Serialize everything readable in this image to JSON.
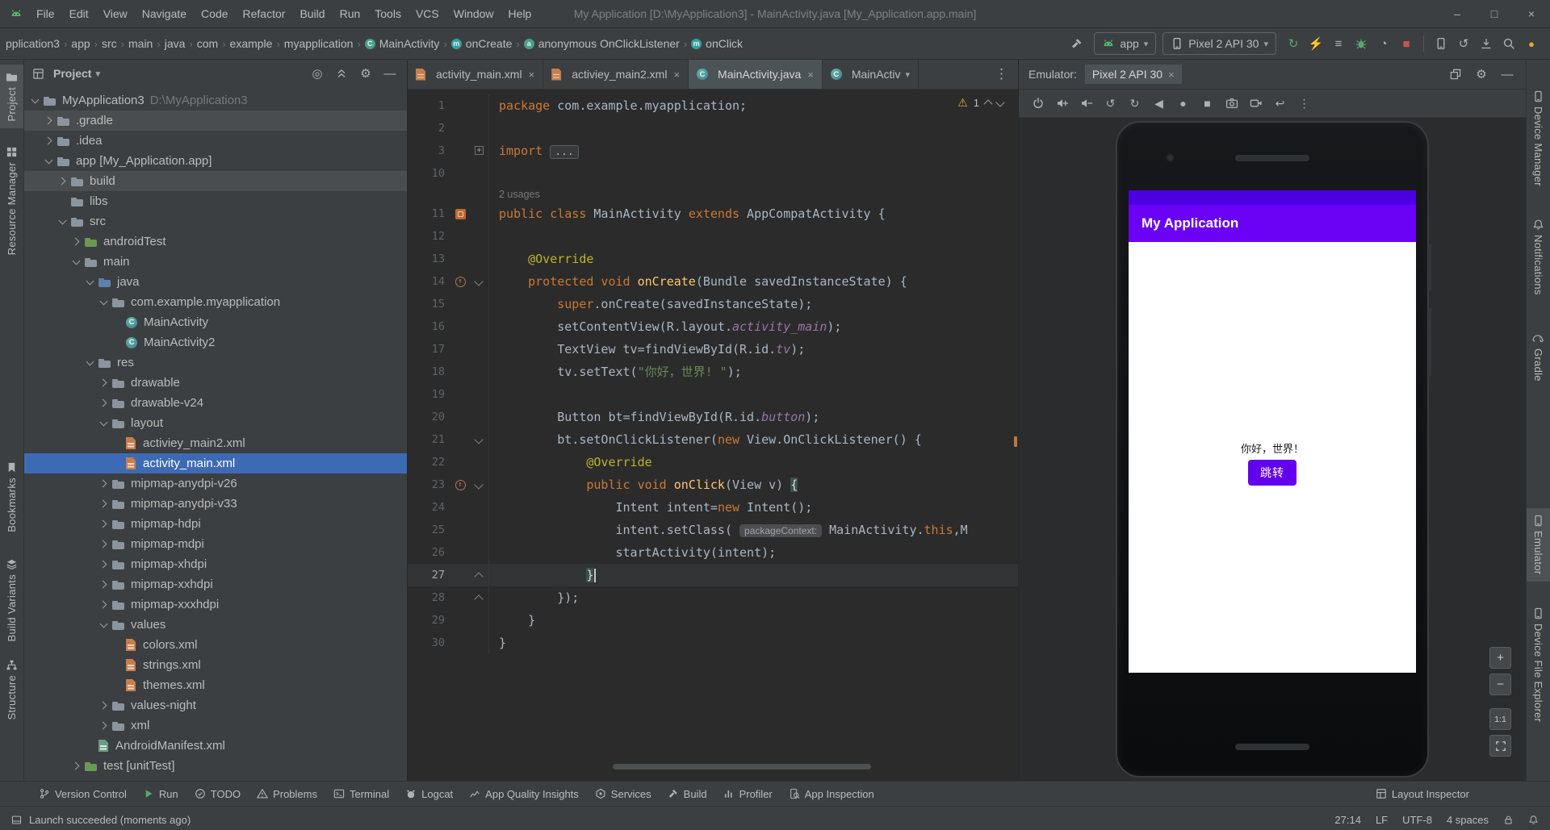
{
  "colors": {
    "selection_blue": "#3D6AB4",
    "accent_green": "#59A869",
    "warning_orange": "#EDA53C",
    "stop_red": "#C75450"
  },
  "titlebar": {
    "menus": [
      "File",
      "Edit",
      "View",
      "Navigate",
      "Code",
      "Refactor",
      "Build",
      "Run",
      "Tools",
      "VCS",
      "Window",
      "Help"
    ],
    "title": "My Application [D:\\MyApplication3] - MainActivity.java [My_Application.app.main]",
    "window_controls": [
      "minimize",
      "maximize",
      "close"
    ]
  },
  "navbar": {
    "breadcrumbs": [
      {
        "label": "pplication3"
      },
      {
        "label": "app"
      },
      {
        "label": "src"
      },
      {
        "label": "main"
      },
      {
        "label": "java"
      },
      {
        "label": "com"
      },
      {
        "label": "example"
      },
      {
        "label": "myapplication"
      },
      {
        "label": "MainActivity",
        "badge": "C",
        "badge_color": "#4A9E8C"
      },
      {
        "label": "onCreate",
        "badge": "m",
        "badge_color": "#35A0A0"
      },
      {
        "label": "anonymous OnClickListener",
        "badge": "a",
        "badge_color": "#4A9E8C"
      },
      {
        "label": "onClick",
        "badge": "m",
        "badge_color": "#35A0A0"
      }
    ],
    "run_config": {
      "label": "app"
    },
    "device_selector": {
      "label": "Pixel 2 API 30"
    },
    "action_icons": [
      {
        "name": "rerun",
        "glyph": "↻",
        "cls": "green"
      },
      {
        "name": "apply-changes",
        "glyph": "⚡",
        "cls": "green"
      },
      {
        "name": "run-options",
        "glyph": "≡",
        "cls": ""
      },
      {
        "name": "debug",
        "svg": "bug",
        "cls": "green"
      },
      {
        "name": "profile",
        "glyph": "◔",
        "cls": ""
      },
      {
        "name": "stop",
        "glyph": "■",
        "cls": "red"
      },
      {
        "sep": true
      },
      {
        "name": "device-manager",
        "svg": "phone2",
        "cls": ""
      },
      {
        "name": "sync-project",
        "glyph": "↺",
        "cls": ""
      },
      {
        "name": "sdk-manager",
        "svg": "download",
        "cls": ""
      },
      {
        "name": "search-everywhere",
        "svg": "search",
        "cls": ""
      },
      {
        "name": "whats-new",
        "glyph": "●",
        "cls": "orange"
      }
    ]
  },
  "left_stripe": [
    {
      "label": "Project",
      "icon": "folder",
      "selected": true
    },
    {
      "label": "Resource Manager",
      "icon": "grid"
    },
    {
      "label": "Bookmarks",
      "icon": "bookmark"
    },
    {
      "label": "Build Variants",
      "icon": "layers"
    },
    {
      "label": "Structure",
      "icon": "structure"
    }
  ],
  "right_stripe": [
    {
      "label": "Device Manager",
      "icon": "phone2"
    },
    {
      "label": "Notifications",
      "icon": "bell"
    },
    {
      "label": "Gradle",
      "icon": "elephant"
    },
    {
      "label": "Emulator",
      "icon": "phone2",
      "selected": true
    },
    {
      "label": "Device File Explorer",
      "icon": "phone2"
    }
  ],
  "project_panel": {
    "title": "Project",
    "header_icons": [
      "locate",
      "collapse-all",
      "settings",
      "hide"
    ],
    "tree": [
      {
        "d": 0,
        "c": "v",
        "i": "folder",
        "l": "MyApplication3",
        "s": "D:\\MyApplication3"
      },
      {
        "d": 1,
        "c": "r",
        "i": "folder",
        "l": ".gradle",
        "sh": true
      },
      {
        "d": 1,
        "c": "r",
        "i": "folder",
        "l": ".idea"
      },
      {
        "d": 1,
        "c": "v",
        "i": "module",
        "l": "app [My_Application.app]"
      },
      {
        "d": 2,
        "c": "r",
        "i": "folder",
        "l": "build",
        "sh": true
      },
      {
        "d": 2,
        "c": "",
        "i": "folder",
        "l": "libs"
      },
      {
        "d": 2,
        "c": "v",
        "i": "folder",
        "l": "src"
      },
      {
        "d": 3,
        "c": "r",
        "i": "folder-test",
        "l": "androidTest"
      },
      {
        "d": 3,
        "c": "v",
        "i": "folder",
        "l": "main"
      },
      {
        "d": 4,
        "c": "v",
        "i": "folder-src",
        "l": "java"
      },
      {
        "d": 5,
        "c": "v",
        "i": "package",
        "l": "com.example.myapplication"
      },
      {
        "d": 6,
        "c": "",
        "i": "class",
        "l": "MainActivity"
      },
      {
        "d": 6,
        "c": "",
        "i": "class",
        "l": "MainActivity2"
      },
      {
        "d": 4,
        "c": "v",
        "i": "folder",
        "l": "res"
      },
      {
        "d": 5,
        "c": "r",
        "i": "folder",
        "l": "drawable"
      },
      {
        "d": 5,
        "c": "r",
        "i": "folder",
        "l": "drawable-v24"
      },
      {
        "d": 5,
        "c": "v",
        "i": "folder",
        "l": "layout"
      },
      {
        "d": 6,
        "c": "",
        "i": "xml",
        "l": "activiey_main2.xml"
      },
      {
        "d": 6,
        "c": "",
        "i": "xml",
        "l": "activity_main.xml",
        "sel": true
      },
      {
        "d": 5,
        "c": "r",
        "i": "folder",
        "l": "mipmap-anydpi-v26"
      },
      {
        "d": 5,
        "c": "r",
        "i": "folder",
        "l": "mipmap-anydpi-v33"
      },
      {
        "d": 5,
        "c": "r",
        "i": "folder",
        "l": "mipmap-hdpi"
      },
      {
        "d": 5,
        "c": "r",
        "i": "folder",
        "l": "mipmap-mdpi"
      },
      {
        "d": 5,
        "c": "r",
        "i": "folder",
        "l": "mipmap-xhdpi"
      },
      {
        "d": 5,
        "c": "r",
        "i": "folder",
        "l": "mipmap-xxhdpi"
      },
      {
        "d": 5,
        "c": "r",
        "i": "folder",
        "l": "mipmap-xxxhdpi"
      },
      {
        "d": 5,
        "c": "v",
        "i": "folder",
        "l": "values"
      },
      {
        "d": 6,
        "c": "",
        "i": "xml",
        "l": "colors.xml"
      },
      {
        "d": 6,
        "c": "",
        "i": "xml",
        "l": "strings.xml"
      },
      {
        "d": 6,
        "c": "",
        "i": "xml",
        "l": "themes.xml"
      },
      {
        "d": 5,
        "c": "r",
        "i": "folder",
        "l": "values-night"
      },
      {
        "d": 5,
        "c": "r",
        "i": "folder",
        "l": "xml"
      },
      {
        "d": 4,
        "c": "",
        "i": "manifest",
        "l": "AndroidManifest.xml"
      },
      {
        "d": 3,
        "c": "r",
        "i": "folder-test",
        "l": "test [unitTest]"
      }
    ]
  },
  "editor": {
    "tabs": [
      {
        "label": "activity_main.xml",
        "icon": "xml",
        "close": true
      },
      {
        "label": "activiey_main2.xml",
        "icon": "xml",
        "close": true
      },
      {
        "label": "MainActivity.java",
        "icon": "class",
        "close": true,
        "selected": true
      },
      {
        "label": "MainActiv",
        "icon": "class",
        "dropdown": true
      }
    ],
    "inspections": {
      "warnings": "1"
    },
    "lines": [
      {
        "n": "1",
        "t": [
          [
            "k",
            "package"
          ],
          [
            "d",
            " com.example.myapplication;"
          ]
        ]
      },
      {
        "n": "2",
        "t": []
      },
      {
        "n": "3",
        "t": [
          [
            "k",
            "import"
          ],
          [
            "d",
            " "
          ],
          [
            "e",
            "..."
          ]
        ],
        "fold": "plus"
      },
      {
        "n": "10",
        "t": []
      },
      {
        "inlay": "2 usages"
      },
      {
        "n": "11",
        "t": [
          [
            "k",
            "public class"
          ],
          [
            "d",
            " MainActivity "
          ],
          [
            "k",
            "extends"
          ],
          [
            "d",
            " AppCompatActivity {"
          ]
        ],
        "marker": "android"
      },
      {
        "n": "12",
        "t": []
      },
      {
        "n": "13",
        "t": [
          [
            "d",
            "    "
          ],
          [
            "a",
            "@Override"
          ]
        ]
      },
      {
        "n": "14",
        "t": [
          [
            "d",
            "    "
          ],
          [
            "k",
            "protected void"
          ],
          [
            "m",
            " onCreate"
          ],
          [
            "d",
            "(Bundle savedInstanceState) {"
          ]
        ],
        "marker": "override",
        "fold": "down"
      },
      {
        "n": "15",
        "t": [
          [
            "d",
            "        "
          ],
          [
            "k",
            "super"
          ],
          [
            "d",
            ".onCreate(savedInstanceState);"
          ]
        ]
      },
      {
        "n": "16",
        "t": [
          [
            "d",
            "        setContentView(R.layout."
          ],
          [
            "f",
            "activity_main"
          ],
          [
            "d",
            ");"
          ]
        ]
      },
      {
        "n": "17",
        "t": [
          [
            "d",
            "        TextView tv=findViewById(R.id."
          ],
          [
            "f",
            "tv"
          ],
          [
            "d",
            ");"
          ]
        ]
      },
      {
        "n": "18",
        "t": [
          [
            "d",
            "        tv.setText("
          ],
          [
            "s",
            "\"你好，世界! \""
          ],
          [
            "d",
            ");"
          ]
        ]
      },
      {
        "n": "19",
        "t": []
      },
      {
        "n": "20",
        "t": [
          [
            "d",
            "        Button bt=findViewById(R.id."
          ],
          [
            "f",
            "button"
          ],
          [
            "d",
            ");"
          ]
        ]
      },
      {
        "n": "21",
        "t": [
          [
            "d",
            "        bt.setOnClickListener("
          ],
          [
            "k",
            "new"
          ],
          [
            "d",
            " View.OnClickListener() {"
          ]
        ],
        "fold": "down"
      },
      {
        "n": "22",
        "t": [
          [
            "d",
            "            "
          ],
          [
            "a",
            "@Override"
          ]
        ]
      },
      {
        "n": "23",
        "t": [
          [
            "d",
            "            "
          ],
          [
            "k",
            "public void"
          ],
          [
            "m",
            " onClick"
          ],
          [
            "d",
            "(View v) "
          ],
          [
            "b",
            "{"
          ]
        ],
        "marker": "override",
        "fold": "down"
      },
      {
        "n": "24",
        "t": [
          [
            "d",
            "                Intent intent="
          ],
          [
            "k",
            "new"
          ],
          [
            "d",
            " Intent();"
          ]
        ]
      },
      {
        "n": "25",
        "t": [
          [
            "d",
            "                intent.setClass( "
          ],
          [
            "h",
            "packageContext:"
          ],
          [
            "d",
            " MainActivity."
          ],
          [
            "k",
            "this"
          ],
          [
            "d",
            ",M"
          ]
        ]
      },
      {
        "n": "26",
        "t": [
          [
            "d",
            "                startActivity(intent);"
          ]
        ]
      },
      {
        "n": "27",
        "t": [
          [
            "d",
            "            "
          ],
          [
            "b",
            "}"
          ]
        ],
        "cur": true,
        "fold": "up"
      },
      {
        "n": "28",
        "t": [
          [
            "d",
            "        });"
          ]
        ],
        "fold": "up"
      },
      {
        "n": "29",
        "t": [
          [
            "d",
            "    }"
          ]
        ]
      },
      {
        "n": "30",
        "t": [
          [
            "d",
            "}"
          ]
        ]
      }
    ]
  },
  "emulator": {
    "panel_label": "Emulator:",
    "tab_label": "Pixel 2 API 30",
    "header_icons": [
      "float",
      "settings",
      "hide"
    ],
    "toolbar_icons": [
      {
        "name": "power",
        "svg": "power"
      },
      {
        "name": "volume-up",
        "svg": "volup"
      },
      {
        "name": "volume-down",
        "svg": "voldown"
      },
      {
        "name": "rotate-left",
        "glyph": "↺"
      },
      {
        "name": "rotate-right",
        "glyph": "↻"
      },
      {
        "name": "back",
        "glyph": "◀"
      },
      {
        "name": "home",
        "glyph": "●"
      },
      {
        "name": "overview",
        "glyph": "■"
      },
      {
        "name": "screenshot",
        "svg": "camera"
      },
      {
        "name": "screen-record",
        "svg": "video"
      },
      {
        "name": "snapshots",
        "glyph": "↩"
      },
      {
        "name": "more",
        "glyph": "⋮"
      }
    ],
    "phone": {
      "app_title": "My Application",
      "greeting_text": "你好，世界！",
      "button_label": "跳转",
      "colors": {
        "status_bar": "#4A00E0",
        "app_bar": "#6A00F4",
        "button": "#6200EE"
      }
    },
    "zoom_controls": [
      {
        "name": "zoom-in",
        "glyph": "+"
      },
      {
        "name": "zoom-out",
        "glyph": "−"
      },
      {
        "name": "zoom-reset",
        "glyph": "1:1"
      },
      {
        "name": "zoom-fit",
        "svg": "fit"
      }
    ]
  },
  "bottom_bar": {
    "items": [
      {
        "label": "Version Control",
        "icon": "branch"
      },
      {
        "label": "Run",
        "icon": "play",
        "cls": "green"
      },
      {
        "label": "TODO",
        "icon": "todo"
      },
      {
        "label": "Problems",
        "icon": "warn"
      },
      {
        "label": "Terminal",
        "icon": "terminal"
      },
      {
        "label": "Logcat",
        "icon": "cat"
      },
      {
        "label": "App Quality Insights",
        "icon": "insights"
      },
      {
        "label": "Services",
        "icon": "services"
      },
      {
        "label": "Build",
        "icon": "hammer"
      },
      {
        "label": "Profiler",
        "icon": "profiler"
      },
      {
        "label": "App Inspection",
        "icon": "inspect"
      }
    ],
    "right_item": {
      "label": "Layout Inspector",
      "icon": "layout"
    }
  },
  "status_bar": {
    "message": "Launch succeeded (moments ago)",
    "caret_position": "27:14",
    "line_separator": "LF",
    "encoding": "UTF-8",
    "indent": "4 spaces"
  }
}
